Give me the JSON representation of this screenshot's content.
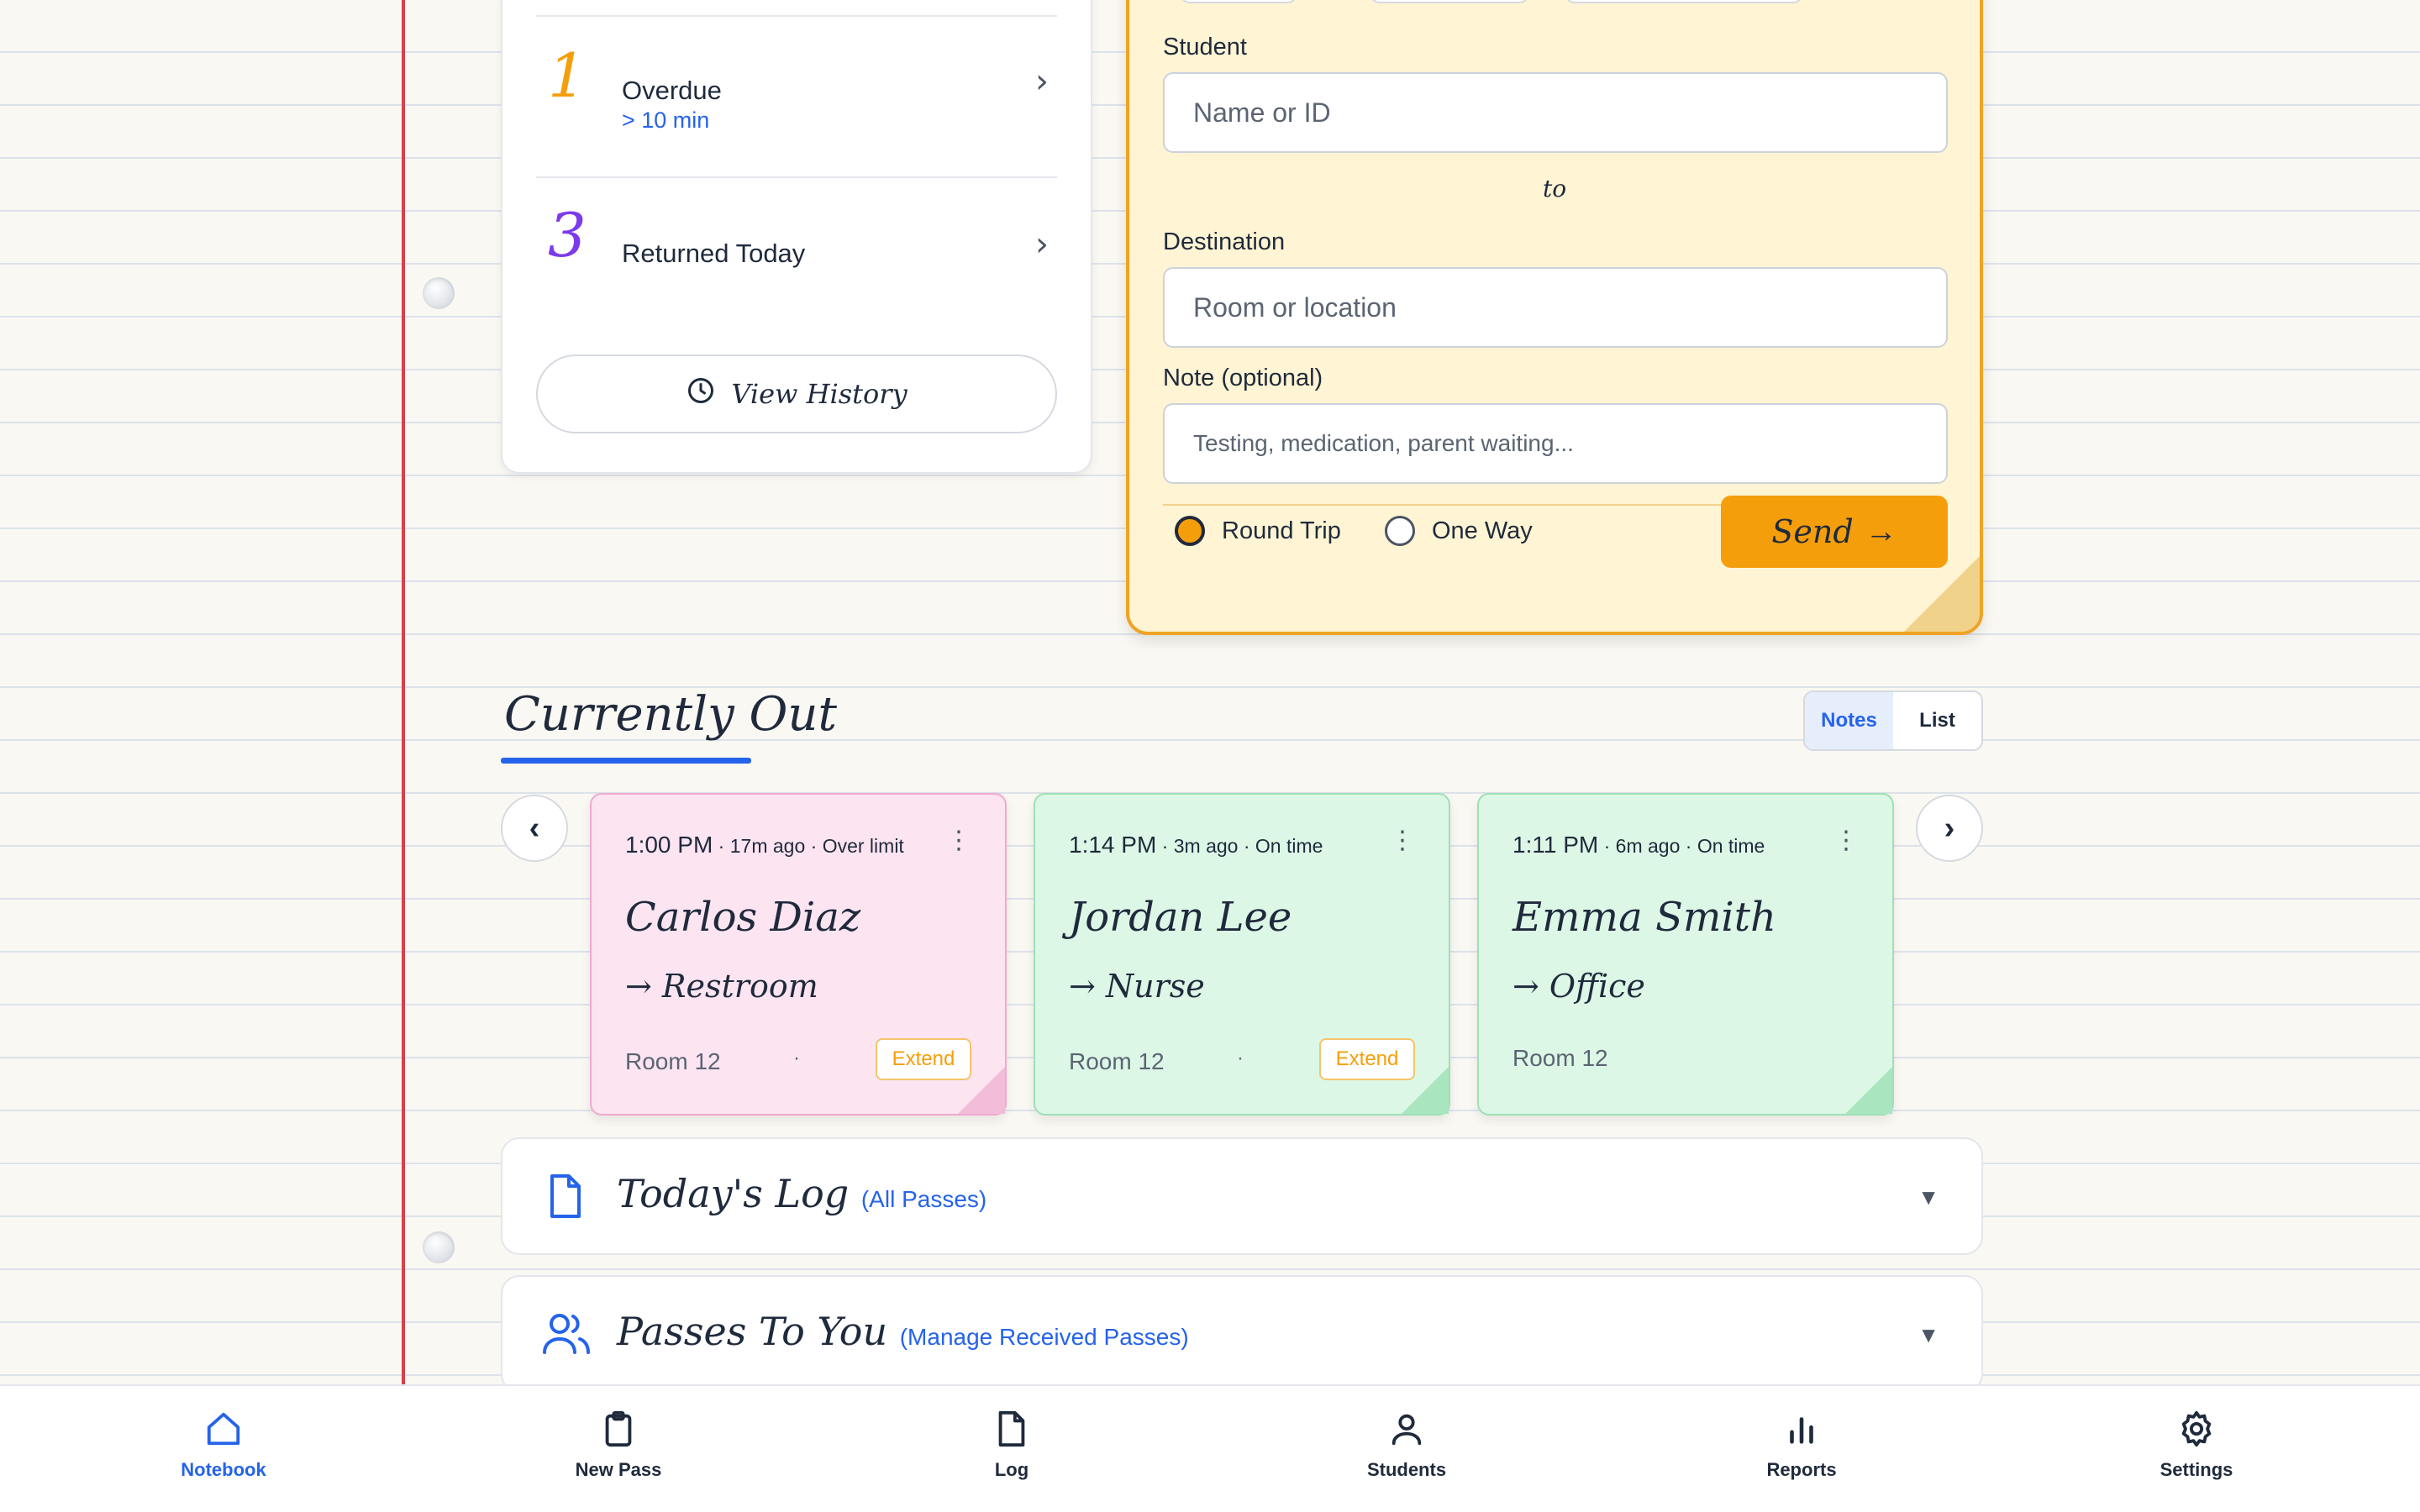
{
  "summary": {
    "overdue": {
      "count": "1",
      "title": "Overdue",
      "sub": "> 10 min",
      "color": "#f59e0b"
    },
    "returned": {
      "count": "3",
      "title": "Returned Today",
      "color": "#7c3aed"
    },
    "history_label": "View History"
  },
  "form": {
    "student_label": "Student",
    "student_placeholder": "Name or ID",
    "to_label": "to",
    "destination_label": "Destination",
    "destination_placeholder": "Room or location",
    "note_label": "Note (optional)",
    "note_placeholder": "Testing, medication, parent waiting...",
    "round_trip_label": "Round Trip",
    "one_way_label": "One Way",
    "selected_trip": "Round Trip",
    "send_label": "Send",
    "accent": "#f59e0b"
  },
  "currently_out": {
    "title": "Currently Out",
    "view_toggle": {
      "notes": "Notes",
      "list": "List",
      "active": "Notes"
    },
    "prev_label": "‹",
    "next_label": "›",
    "passes": [
      {
        "time": "1:00 PM",
        "elapsed": "17m ago",
        "status": "Over limit",
        "name": "Carlos Diaz",
        "destination": "Restroom",
        "room": "Room 12",
        "extend_label": "Extend",
        "color": "pink"
      },
      {
        "time": "1:14 PM",
        "elapsed": "3m ago",
        "status": "On time",
        "name": "Jordan Lee",
        "destination": "Nurse",
        "room": "Room 12",
        "extend_label": "Extend",
        "color": "green"
      },
      {
        "time": "1:11 PM",
        "elapsed": "6m ago",
        "status": "On time",
        "name": "Emma Smith",
        "destination": "Office",
        "room": "Room 12",
        "color": "green"
      }
    ]
  },
  "accordions": {
    "log": {
      "title": "Today's Log",
      "sub": "(All Passes)"
    },
    "received": {
      "title": "Passes To You",
      "sub": "(Manage Received Passes)"
    }
  },
  "bottom_nav": {
    "active": "Notebook",
    "items": [
      {
        "label": "Notebook",
        "icon": "home-icon"
      },
      {
        "label": "New Pass",
        "icon": "clipboard-icon"
      },
      {
        "label": "Log",
        "icon": "document-icon"
      },
      {
        "label": "Students",
        "icon": "person-icon"
      },
      {
        "label": "Reports",
        "icon": "bar-chart-icon"
      },
      {
        "label": "Settings",
        "icon": "gear-icon"
      }
    ]
  }
}
